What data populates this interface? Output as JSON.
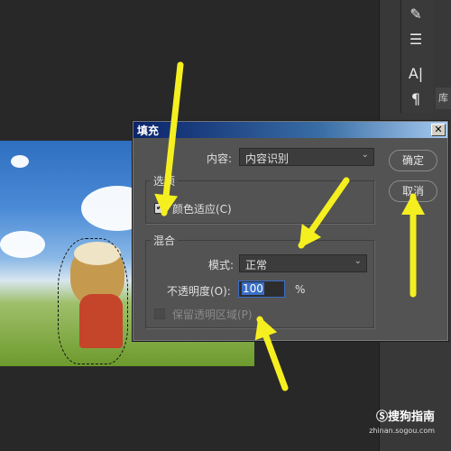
{
  "dialog": {
    "title": "填充",
    "content_label": "内容:",
    "content_value": "内容识别",
    "options_title": "选项",
    "color_adapt_label": "颜色适应(C)",
    "color_adapt_checked": true,
    "blend_title": "混合",
    "mode_label": "模式:",
    "mode_value": "正常",
    "opacity_label": "不透明度(O):",
    "opacity_value": "100",
    "opacity_unit": "%",
    "preserve_label": "保留透明区域(P)",
    "preserve_checked": false,
    "ok_label": "确定",
    "cancel_label": "取消",
    "close_glyph": "✕"
  },
  "panel": {
    "tab_label": "库",
    "tools": [
      {
        "icon": "brush-icon",
        "glyph": "✎"
      },
      {
        "icon": "sliders-icon",
        "glyph": "☰"
      },
      {
        "icon": "character-icon",
        "glyph": "A|"
      },
      {
        "icon": "paragraph-icon",
        "glyph": "¶"
      }
    ]
  },
  "watermark": {
    "brand": "Ⓢ搜狗指南",
    "url": "zhinan.sogou.com"
  },
  "colors": {
    "arrow": "#f5ef1f",
    "dialog_bg": "#535353",
    "title_bar_start": "#0a246a",
    "title_bar_end": "#a6caf0"
  }
}
